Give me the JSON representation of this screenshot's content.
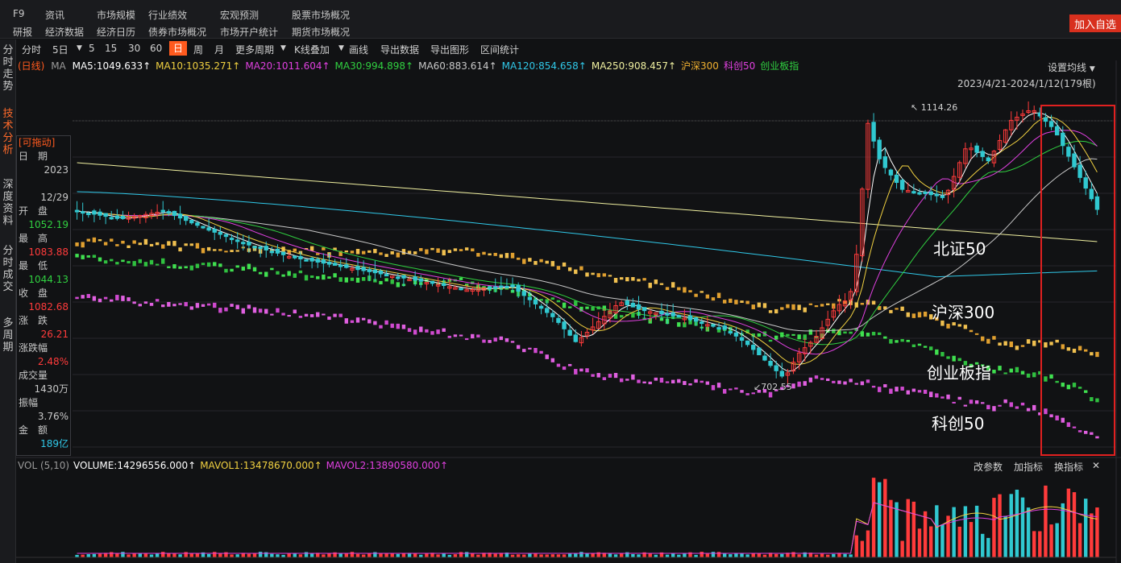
{
  "nav": {
    "row1": [
      "F9",
      "资讯",
      "市场规模",
      "行业绩效",
      "宏观预测",
      "股票市场概况"
    ],
    "row2": [
      "研报",
      "经济数据",
      "经济日历",
      "债券市场概况",
      "市场开户统计",
      "期货市场概况"
    ],
    "join_button": "加入自选"
  },
  "leftbar": [
    {
      "label": "分时走势",
      "active": false
    },
    {
      "label": "技术分析",
      "active": true
    },
    {
      "label": "深度资料",
      "active": false
    },
    {
      "label": "分时成交",
      "active": false
    },
    {
      "label": "多周期",
      "active": false
    }
  ],
  "toolbar": {
    "items": [
      "分时",
      "5日",
      "5",
      "15",
      "30",
      "60",
      "日",
      "周",
      "月",
      "更多周期",
      "K线叠加",
      "画线",
      "导出数据",
      "导出图形",
      "区间统计"
    ],
    "active": "日"
  },
  "ma_legend": {
    "period": "(日线)",
    "ma_prefix": "MA",
    "items": [
      {
        "text": "MA5:1049.633↑",
        "color": "#ffffff"
      },
      {
        "text": "MA10:1035.271↑",
        "color": "#f0d040"
      },
      {
        "text": "MA20:1011.604↑",
        "color": "#e040e0"
      },
      {
        "text": "MA30:994.898↑",
        "color": "#30d040"
      },
      {
        "text": "MA60:883.614↑",
        "color": "#c8c8c8"
      },
      {
        "text": "MA120:854.658↑",
        "color": "#30c8e8"
      },
      {
        "text": "MA250:908.457↑",
        "color": "#f0f0a0"
      },
      {
        "text": "沪深300",
        "color": "#f0b030"
      },
      {
        "text": "科创50",
        "color": "#e040e0"
      },
      {
        "text": "创业板指",
        "color": "#30d040"
      }
    ],
    "settings_label": "设置均线"
  },
  "range_label": "2023/4/21-2024/1/12(179根)",
  "info_panel": {
    "title": "[可拖动]",
    "rows": [
      {
        "label": "日　期",
        "value": "2023"
      },
      {
        "label": "",
        "value": "12/29"
      },
      {
        "label": "开　盘",
        "value": "1052.19",
        "color": "#30d040"
      },
      {
        "label": "最　高",
        "value": "1083.88",
        "color": "#ff3b3b"
      },
      {
        "label": "最　低",
        "value": "1044.13",
        "color": "#30d040"
      },
      {
        "label": "收　盘",
        "value": "1082.68",
        "color": "#ff3b3b"
      },
      {
        "label": "涨　跌",
        "value": "26.21",
        "color": "#ff3b3b"
      },
      {
        "label": "涨跌幅",
        "value": "2.48%",
        "color": "#ff3b3b"
      },
      {
        "label": "成交量",
        "value": "1430万",
        "color": "#c8c8c8"
      },
      {
        "label": "振幅",
        "value": "3.76%",
        "color": "#c8c8c8"
      },
      {
        "label": "金　额",
        "value": "189亿",
        "color": "#30c8e8"
      }
    ]
  },
  "chart_labels": {
    "high_marker": "1114.26",
    "low_marker": "702.55"
  },
  "annotations": [
    "北证50",
    "沪深300",
    "创业板指",
    "科创50"
  ],
  "volume_legend": {
    "items": [
      {
        "text": "VOL (5,10)",
        "color": "#9a9a9a"
      },
      {
        "text": "VOLUME:14296556.000↑",
        "color": "#ffffff"
      },
      {
        "text": "MAVOL1:13478670.000↑",
        "color": "#f0d040"
      },
      {
        "text": "MAVOL2:13890580.000↑",
        "color": "#e040e0"
      }
    ],
    "controls": [
      "改参数",
      "加指标",
      "换指标"
    ],
    "close": "✕"
  },
  "colors": {
    "up": "#ff3b3b",
    "down": "#30c8d0",
    "highlight_box": "#e02020",
    "accent": "#ff5a1e"
  },
  "chart_data": {
    "type": "candlestick",
    "range": "2023/4/21-2024/1/12",
    "bars": 179,
    "y_high": 1114.26,
    "y_low": 702.55,
    "last_close": 1082.68,
    "series": [
      {
        "name": "沪深300"
      },
      {
        "name": "科创50"
      },
      {
        "name": "创业板指"
      }
    ],
    "indicators": [
      "MA5",
      "MA10",
      "MA20",
      "MA30",
      "MA60",
      "MA120",
      "MA250"
    ]
  }
}
